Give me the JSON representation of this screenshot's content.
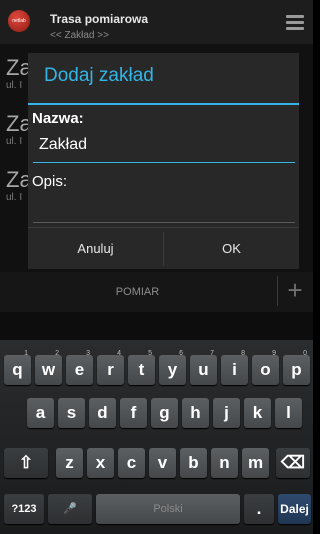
{
  "actionbar": {
    "logo_text": "netlab",
    "title": "Trasa pomiarowa",
    "subtitle": "<< Zakład >>"
  },
  "background_list": [
    {
      "name": "Za",
      "address": "ul. I"
    },
    {
      "name": "Za",
      "address": "ul. I"
    },
    {
      "name": "Za",
      "address": "ul. I"
    }
  ],
  "bottom_bar": {
    "tab_label": "POMIAR",
    "add_glyph": "+"
  },
  "dialog": {
    "title": "Dodaj zakład",
    "name_label": "Nazwa:",
    "name_value": "Zakład",
    "desc_label": "Opis:",
    "desc_value": "",
    "cancel_label": "Anuluj",
    "ok_label": "OK"
  },
  "keyboard": {
    "row1": [
      {
        "key": "q",
        "hint": "1"
      },
      {
        "key": "w",
        "hint": "2"
      },
      {
        "key": "e",
        "hint": "3"
      },
      {
        "key": "r",
        "hint": "4"
      },
      {
        "key": "t",
        "hint": "5"
      },
      {
        "key": "y",
        "hint": "6"
      },
      {
        "key": "u",
        "hint": "7"
      },
      {
        "key": "i",
        "hint": "8"
      },
      {
        "key": "o",
        "hint": "9"
      },
      {
        "key": "p",
        "hint": "0"
      }
    ],
    "row2": [
      "a",
      "s",
      "d",
      "f",
      "g",
      "h",
      "j",
      "k",
      "l"
    ],
    "row3": [
      "z",
      "x",
      "c",
      "v",
      "b",
      "n",
      "m"
    ],
    "shift_glyph": "⇧",
    "backspace_glyph": "⌫",
    "symbols_label": "?123",
    "mic_glyph": "🎤",
    "space_label": "Polski",
    "period_label": ".",
    "action_label": "Dalej"
  }
}
